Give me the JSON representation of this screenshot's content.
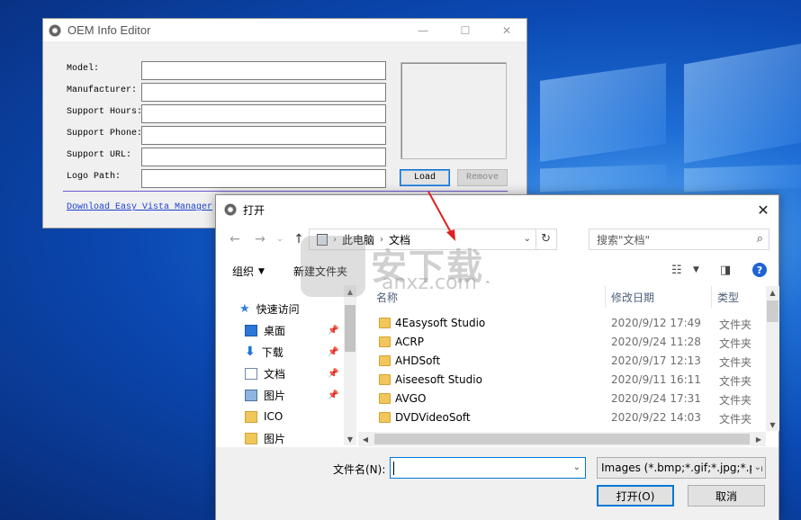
{
  "oem_window": {
    "title": "OEM Info Editor",
    "controls": {
      "minimize": "—",
      "maximize": "☐",
      "close": "✕"
    },
    "fields": [
      {
        "label": "Model:",
        "value": ""
      },
      {
        "label": "Manufacturer:",
        "value": ""
      },
      {
        "label": "Support Hours:",
        "value": ""
      },
      {
        "label": "Support Phone:",
        "value": ""
      },
      {
        "label": "Support URL:",
        "value": ""
      },
      {
        "label": "Logo Path:",
        "value": ""
      }
    ],
    "load_label": "Load",
    "remove_label": "Remove",
    "download_link": "Download Easy Vista Manager"
  },
  "open_dialog": {
    "title": "打开",
    "address": {
      "root": "此电脑",
      "folder": "文档"
    },
    "search_placeholder": "搜索\"文档\"",
    "toolbar": {
      "organize": "组织",
      "new_folder": "新建文件夹"
    },
    "nav_items": [
      {
        "label": "快速访问",
        "icon": "star-icon",
        "pinned": false
      },
      {
        "label": "桌面",
        "icon": "desktop-icon",
        "pinned": true
      },
      {
        "label": "下载",
        "icon": "download-icon",
        "pinned": true
      },
      {
        "label": "文档",
        "icon": "document-icon",
        "pinned": true
      },
      {
        "label": "图片",
        "icon": "pictures-icon",
        "pinned": true
      },
      {
        "label": "ICO",
        "icon": "folder-icon",
        "pinned": false
      },
      {
        "label": "图片",
        "icon": "folder-icon",
        "pinned": false
      }
    ],
    "columns": {
      "name": "名称",
      "date": "修改日期",
      "type": "类型"
    },
    "files": [
      {
        "name": "4Easysoft Studio",
        "date": "2020/9/12 17:49",
        "type": "文件夹"
      },
      {
        "name": "ACRP",
        "date": "2020/9/24 11:28",
        "type": "文件夹"
      },
      {
        "name": "AHDSoft",
        "date": "2020/9/17 12:13",
        "type": "文件夹"
      },
      {
        "name": "Aiseesoft Studio",
        "date": "2020/9/11 16:11",
        "type": "文件夹"
      },
      {
        "name": "AVGO",
        "date": "2020/9/24 17:31",
        "type": "文件夹"
      },
      {
        "name": "DVDVideoSoft",
        "date": "2020/9/22 14:03",
        "type": "文件夹"
      }
    ],
    "filename_label": "文件名(N):",
    "filename_value": "",
    "filter_value": "Images (*.bmp;*.gif;*.jpg;*.pn",
    "open_label": "打开(O)",
    "cancel_label": "取消"
  },
  "watermark": {
    "cn": "安下载",
    "en": "anxz.com"
  },
  "colors": {
    "accent": "#0078d7",
    "link": "#1b3fd1",
    "arrow": "#e02020",
    "folder": "#f1c75b"
  }
}
